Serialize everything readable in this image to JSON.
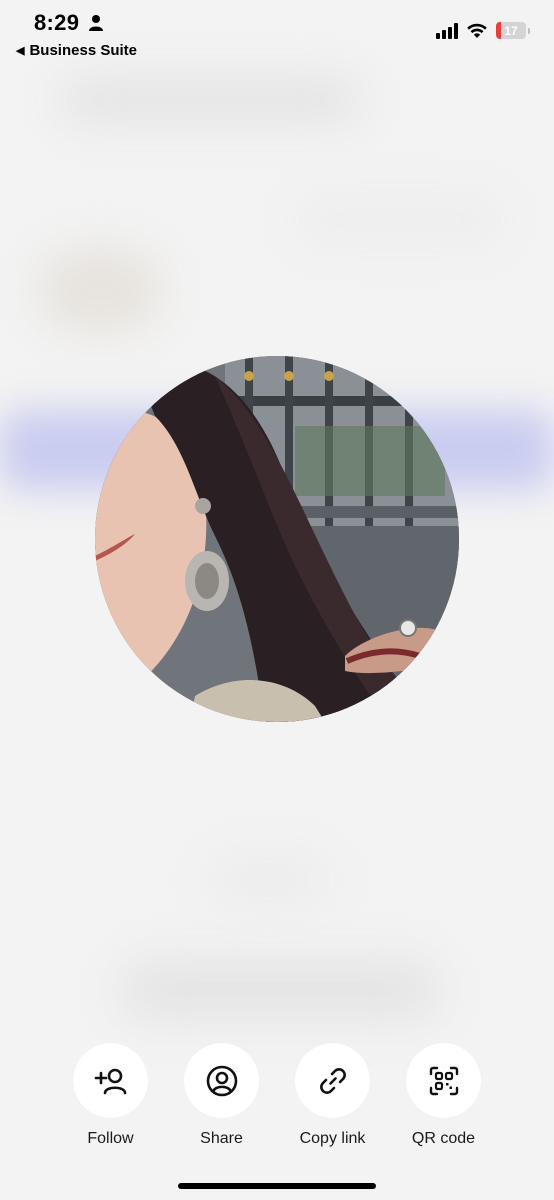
{
  "status_bar": {
    "time": "8:29",
    "back_label": "Business Suite",
    "battery_level": "17",
    "battery_fraction": 0.17,
    "battery_color": "#e5413b"
  },
  "profile": {
    "avatar_icon": "profile-photo"
  },
  "actions": [
    {
      "label": "Follow",
      "icon": "follow-icon"
    },
    {
      "label": "Share",
      "icon": "share-icon"
    },
    {
      "label": "Copy link",
      "icon": "link-icon"
    },
    {
      "label": "QR code",
      "icon": "qr-code-icon"
    }
  ]
}
